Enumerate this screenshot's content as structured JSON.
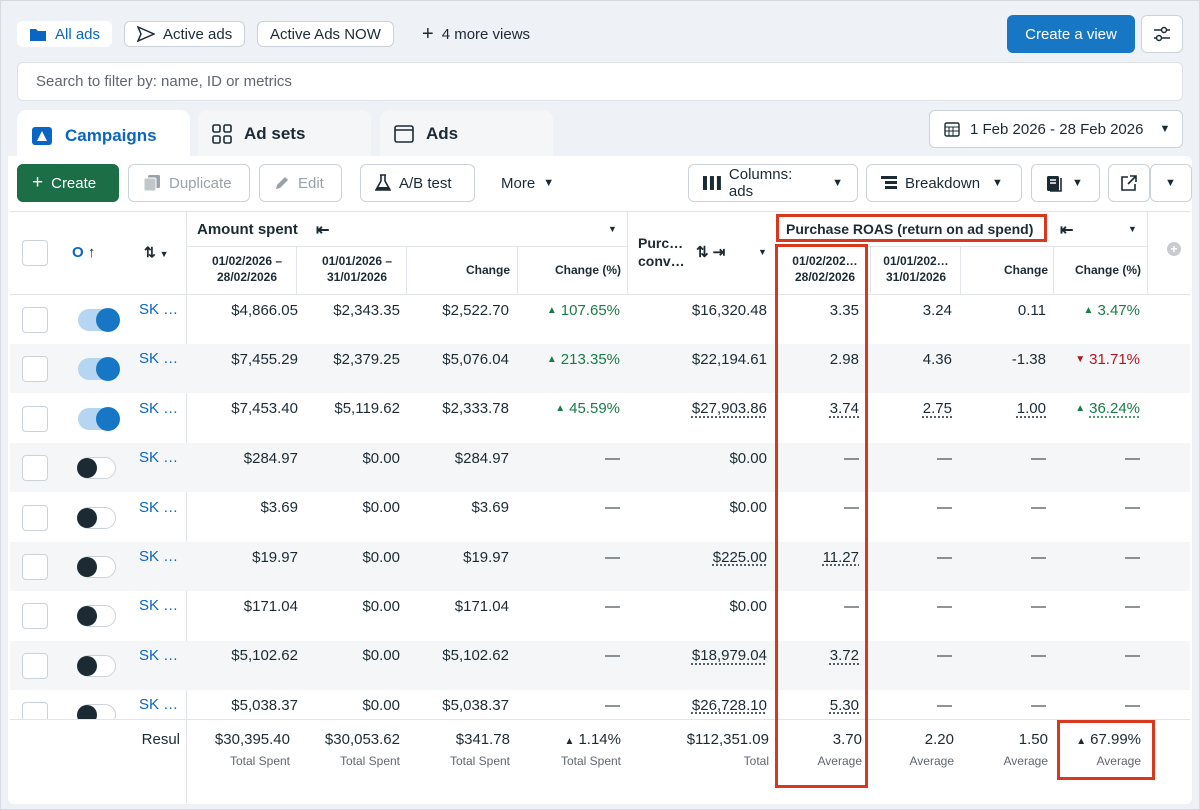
{
  "views": {
    "all_ads": "All ads",
    "active_ads": "Active ads",
    "active_now": "Active Ads NOW",
    "more_views": "4 more views",
    "create_view": "Create a view"
  },
  "search": {
    "placeholder": "Search to filter by: name, ID or metrics"
  },
  "levels": {
    "campaigns": "Campaigns",
    "ad_sets": "Ad sets",
    "ads": "Ads"
  },
  "date_range": "1 Feb 2026 - 28 Feb 2026",
  "toolbar": {
    "create": "Create",
    "duplicate": "Duplicate",
    "edit": "Edit",
    "ab_test": "A/B test",
    "more": "More",
    "columns": "Columns: ads",
    "breakdown": "Breakdown"
  },
  "columns": {
    "off_sort": "O",
    "amount_spent": "Amount spent",
    "purchase_conv_1": "Purc…",
    "purchase_conv_2": "conv…",
    "roas": "Purchase ROAS (return on ad spend)",
    "period_a_1": "01/02/2026 –",
    "period_a_2": "28/02/2026",
    "period_b_1": "01/01/2026 –",
    "period_b_2": "31/01/2026",
    "roas_a_1": "01/02/202…",
    "roas_a_2": "28/02/2026",
    "roas_b_1": "01/01/202…",
    "roas_b_2": "31/01/2026",
    "change": "Change",
    "change_pct": "Change (%)"
  },
  "rows": [
    {
      "name": "SK …",
      "on": true,
      "s1": "$4,866.05",
      "s2": "$2,343.35",
      "chg": "$2,522.70",
      "pct": "107.65%",
      "dir": "up",
      "conv": "$16,320.48",
      "r1": "3.35",
      "r2": "3.24",
      "rchg": "0.11",
      "rpct": "3.47%",
      "rdir": "up",
      "ul": false
    },
    {
      "name": "SK …",
      "on": true,
      "s1": "$7,455.29",
      "s2": "$2,379.25",
      "chg": "$5,076.04",
      "pct": "213.35%",
      "dir": "up",
      "conv": "$22,194.61",
      "r1": "2.98",
      "r2": "4.36",
      "rchg": "-1.38",
      "rpct": "31.71%",
      "rdir": "down",
      "ul": false
    },
    {
      "name": "SK …",
      "on": true,
      "s1": "$7,453.40",
      "s2": "$5,119.62",
      "chg": "$2,333.78",
      "pct": "45.59%",
      "dir": "up",
      "conv": "$27,903.86",
      "r1": "3.74",
      "r2": "2.75",
      "rchg": "1.00",
      "rpct": "36.24%",
      "rdir": "up",
      "ul": true
    },
    {
      "name": "SK …",
      "on": false,
      "s1": "$284.97",
      "s2": "$0.00",
      "chg": "$284.97",
      "pct": "—",
      "dir": "",
      "conv": "$0.00",
      "r1": "—",
      "r2": "—",
      "rchg": "—",
      "rpct": "—",
      "rdir": "",
      "ul": false
    },
    {
      "name": "SK …",
      "on": false,
      "s1": "$3.69",
      "s2": "$0.00",
      "chg": "$3.69",
      "pct": "—",
      "dir": "",
      "conv": "$0.00",
      "r1": "—",
      "r2": "—",
      "rchg": "—",
      "rpct": "—",
      "rdir": "",
      "ul": false
    },
    {
      "name": "SK …",
      "on": false,
      "s1": "$19.97",
      "s2": "$0.00",
      "chg": "$19.97",
      "pct": "—",
      "dir": "",
      "conv": "$225.00",
      "r1": "11.27",
      "r2": "—",
      "rchg": "—",
      "rpct": "—",
      "rdir": "",
      "ul": false,
      "ulconv": true
    },
    {
      "name": "SK …",
      "on": false,
      "s1": "$171.04",
      "s2": "$0.00",
      "chg": "$171.04",
      "pct": "—",
      "dir": "",
      "conv": "$0.00",
      "r1": "—",
      "r2": "—",
      "rchg": "—",
      "rpct": "—",
      "rdir": "",
      "ul": false
    },
    {
      "name": "SK …",
      "on": false,
      "s1": "$5,102.62",
      "s2": "$0.00",
      "chg": "$5,102.62",
      "pct": "—",
      "dir": "",
      "conv": "$18,979.04",
      "r1": "3.72",
      "r2": "—",
      "rchg": "—",
      "rpct": "—",
      "rdir": "",
      "ul": false,
      "ulconv": true
    },
    {
      "name": "SK …",
      "on": false,
      "s1": "$5,038.37",
      "s2": "$0.00",
      "chg": "$5,038.37",
      "pct": "—",
      "dir": "",
      "conv": "$26,728.10",
      "r1": "5.30",
      "r2": "—",
      "rchg": "—",
      "rpct": "—",
      "rdir": "",
      "ul": false,
      "ulconv": true
    }
  ],
  "footer": {
    "label": "Resul",
    "s1": "$30,395.40",
    "s1_sub": "Total Spent",
    "s2": "$30,053.62",
    "s2_sub": "Total Spent",
    "chg": "$341.78",
    "chg_sub": "Total Spent",
    "pct": "1.14%",
    "pct_sub": "Total Spent",
    "conv": "$112,351.09",
    "conv_sub": "Total",
    "r1": "3.70",
    "r1_sub": "Average",
    "r2": "2.20",
    "r2_sub": "Average",
    "rchg": "1.50",
    "rchg_sub": "Average",
    "rpct": "67.99%",
    "rpct_sub": "Average"
  }
}
